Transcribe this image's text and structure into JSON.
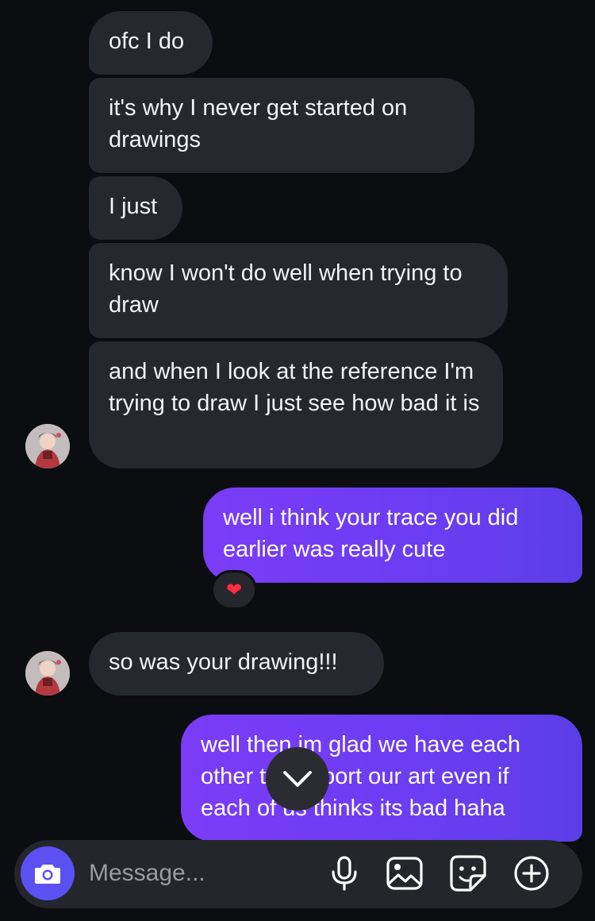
{
  "messages": {
    "m1": {
      "text": "ofc I do"
    },
    "m2": {
      "text": "it's why I never get started on drawings"
    },
    "m3": {
      "text": "I just"
    },
    "m4": {
      "text": "know I won't do well when trying to draw"
    },
    "m5": {
      "text": "and when I look at the reference I'm trying to draw I just see how bad it is"
    },
    "m6": {
      "text": "well i think your trace you did earlier was really cute"
    },
    "m6_reaction": "❤",
    "m7": {
      "text": "so was your drawing!!!"
    },
    "m8": {
      "text": "well then im glad we have each other to support our art even if each of us thinks its bad haha"
    }
  },
  "composer": {
    "placeholder": "Message..."
  },
  "icons": {
    "camera": "camera-icon",
    "mic": "microphone-icon",
    "gallery": "image-icon",
    "sticker": "sticker-icon",
    "add": "plus-circle-icon",
    "scroll": "chevron-down-icon",
    "reaction": "heart-icon"
  },
  "colors": {
    "background": "#0b0d10",
    "incoming_bubble": "#262830",
    "outgoing_bubble_start": "#7b3cf6",
    "outgoing_bubble_end": "#5b3ee8",
    "camera_button": "#5b51f2"
  }
}
